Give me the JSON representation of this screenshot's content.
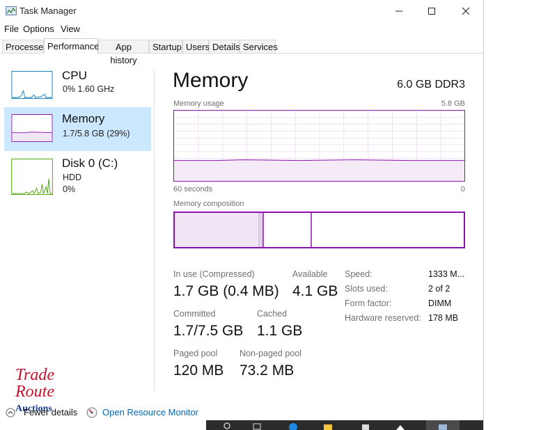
{
  "window": {
    "title": "Task Manager"
  },
  "menu": [
    {
      "label": "File"
    },
    {
      "label": "Options"
    },
    {
      "label": "View"
    }
  ],
  "tabs": [
    {
      "label": "Processes",
      "active": false
    },
    {
      "label": "Performance",
      "active": true
    },
    {
      "label": "App history",
      "active": false
    },
    {
      "label": "Startup",
      "active": false
    },
    {
      "label": "Users",
      "active": false
    },
    {
      "label": "Details",
      "active": false
    },
    {
      "label": "Services",
      "active": false
    }
  ],
  "sidebar": {
    "items": [
      {
        "name": "CPU",
        "sub1": "0%  1.60 GHz",
        "sub2": "",
        "selected": false,
        "color": "#117dbb"
      },
      {
        "name": "Memory",
        "sub1": "1.7/5.8 GB (29%)",
        "sub2": "",
        "selected": true,
        "color": "#8b12ae"
      },
      {
        "name": "Disk 0 (C:)",
        "sub1": "HDD",
        "sub2": "0%",
        "selected": false,
        "color": "#4da60c"
      }
    ]
  },
  "main": {
    "title": "Memory",
    "spec": "6.0 GB DDR3",
    "usage_label": "Memory usage",
    "usage_max": "5.8 GB",
    "time_left": "60 seconds",
    "time_right": "0",
    "composition_label": "Memory composition",
    "stats": {
      "in_use_label": "In use (Compressed)",
      "in_use_value": "1.7 GB (0.4 MB)",
      "available_label": "Available",
      "available_value": "4.1 GB",
      "committed_label": "Committed",
      "committed_value": "1.7/7.5 GB",
      "cached_label": "Cached",
      "cached_value": "1.1 GB",
      "paged_label": "Paged pool",
      "paged_value": "120 MB",
      "nonpaged_label": "Non-paged pool",
      "nonpaged_value": "73.2 MB"
    },
    "details": [
      {
        "label": "Speed:",
        "value": "1333 M..."
      },
      {
        "label": "Slots used:",
        "value": "2 of 2"
      },
      {
        "label": "Form factor:",
        "value": "DIMM"
      },
      {
        "label": "Hardware reserved:",
        "value": "178 MB"
      }
    ]
  },
  "footer": {
    "fewer_details": "Fewer details",
    "open_resource_monitor": "Open Resource Monitor"
  },
  "watermark": {
    "line1": "Trade",
    "line2": "Route",
    "line3": "Auctions"
  },
  "colors": {
    "memory_accent": "#8b12ae",
    "cpu_accent": "#117dbb",
    "disk_accent": "#4da60c",
    "selected_bg": "#cce8ff",
    "link": "#0066b4"
  }
}
